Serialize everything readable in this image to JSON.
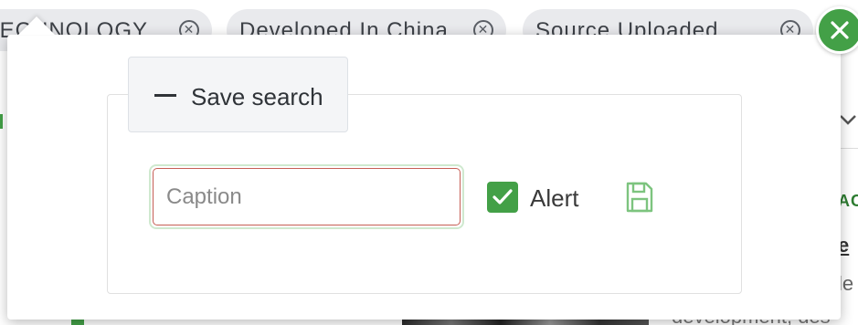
{
  "filter_chips": [
    {
      "label": "TECHNOLOGY"
    },
    {
      "label": "Developed In China"
    },
    {
      "label": "Source Uploaded"
    }
  ],
  "icons": {
    "chip_remove": "circle-x-icon",
    "close_panel": "close-icon",
    "save": "floppy-disk-icon",
    "collapse": "minus-icon",
    "checkbox": "check-icon",
    "chevron": "chevron-down-icon"
  },
  "background_content": {
    "tag_fragment": "AC",
    "link_fragment": "e",
    "text_fragment": "le",
    "text_line": "development, des"
  },
  "save_search": {
    "legend_label": "Save search",
    "caption_input": {
      "value": "",
      "placeholder": "Caption"
    },
    "alert": {
      "label": "Alert",
      "checked": true
    }
  },
  "colors": {
    "accent_green": "#43a047",
    "input_error_border": "#c65e55",
    "chip_bg": "#e9eaed"
  }
}
